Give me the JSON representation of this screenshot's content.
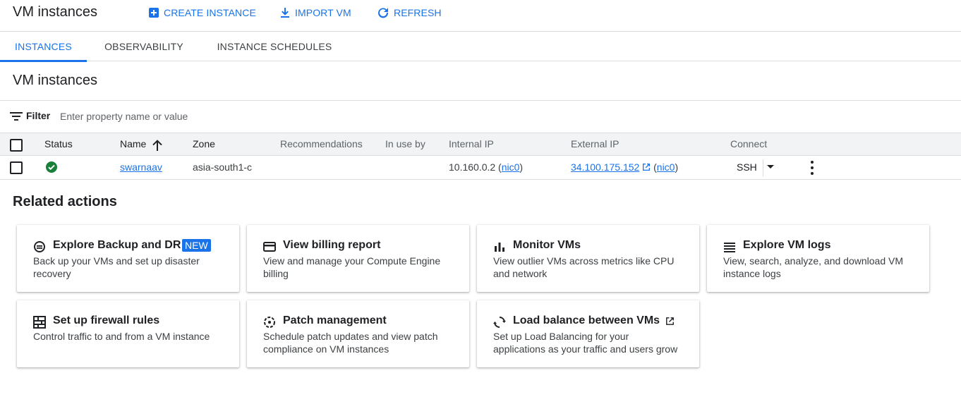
{
  "header": {
    "title": "VM instances",
    "actions": [
      {
        "label": "CREATE INSTANCE",
        "icon": "add-box-icon"
      },
      {
        "label": "IMPORT VM",
        "icon": "download-icon"
      },
      {
        "label": "REFRESH",
        "icon": "refresh-icon"
      }
    ]
  },
  "tabs": [
    {
      "label": "INSTANCES",
      "active": true
    },
    {
      "label": "OBSERVABILITY",
      "active": false
    },
    {
      "label": "INSTANCE SCHEDULES",
      "active": false
    }
  ],
  "section_title": "VM instances",
  "filter": {
    "label": "Filter",
    "placeholder": "Enter property name or value"
  },
  "table": {
    "columns": [
      "Status",
      "Name",
      "Zone",
      "Recommendations",
      "In use by",
      "Internal IP",
      "External IP",
      "Connect"
    ],
    "rows": [
      {
        "name": "swarnaav",
        "zone": "asia-south1-c",
        "internal_ip": "10.160.0.2",
        "internal_nic": "nic0",
        "external_ip": "34.100.175.152",
        "external_nic": "nic0",
        "connect": "SSH"
      }
    ]
  },
  "related": {
    "title": "Related actions",
    "cards": [
      {
        "title": "Explore Backup and DR",
        "badge": "NEW",
        "desc": "Back up your VMs and set up disaster recovery",
        "icon": "backup-icon"
      },
      {
        "title": "View billing report",
        "desc": "View and manage your Compute Engine billing",
        "icon": "credit-card-icon"
      },
      {
        "title": "Monitor VMs",
        "desc": "View outlier VMs across metrics like CPU and network",
        "icon": "bar-chart-icon"
      },
      {
        "title": "Explore VM logs",
        "desc": "View, search, analyze, and download VM instance logs",
        "icon": "logs-list-icon"
      },
      {
        "title": "Set up firewall rules",
        "desc": "Control traffic to and from a VM instance",
        "icon": "firewall-icon"
      },
      {
        "title": "Patch management",
        "desc": "Schedule patch updates and view patch compliance on VM instances",
        "icon": "patch-icon"
      },
      {
        "title": "Load balance between VMs",
        "desc": "Set up Load Balancing for your applications as your traffic and users grow",
        "icon": "sync-icon"
      }
    ]
  },
  "colors": {
    "accent": "#1a73e8",
    "status_ok": "#188038",
    "text": "#202124"
  }
}
